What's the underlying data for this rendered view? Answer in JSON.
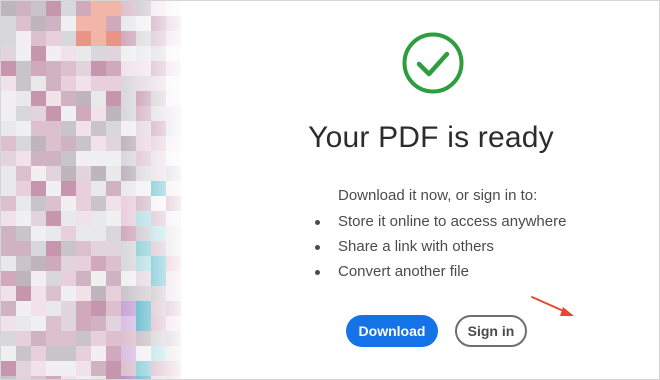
{
  "colors": {
    "accent": "#1473e6",
    "success": "#2d9d3f",
    "annotation_arrow": "#e8452c"
  },
  "icons": {
    "status": "check-circle-icon",
    "annotation": "arrow-icon"
  },
  "dialog": {
    "title": "Your PDF is ready",
    "intro": "Download it now, or sign in to:",
    "bullets": [
      "Store it online to access anywhere",
      "Share a link with others",
      "Convert another file"
    ],
    "download_label": "Download",
    "signin_label": "Sign in"
  }
}
